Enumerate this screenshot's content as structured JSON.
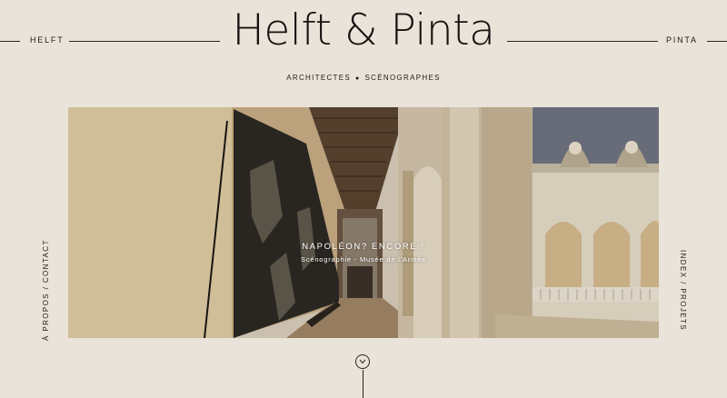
{
  "header": {
    "brand": "Helft & Pinta",
    "tagline_left": "ARCHITECTES",
    "tagline_right": "SCÉNOGRAPHES",
    "left_name": "HELFT",
    "right_name": "PINTA"
  },
  "hero": {
    "title": "NAPOLÉON? ENCORE !",
    "subtitle": "Scénographie - Musée de l'Armée"
  },
  "nav": {
    "left": "À PROPOS / CONTACT",
    "right": "INDEX / PROJETS"
  },
  "scroll": {
    "icon": "chevron-down-icon"
  }
}
